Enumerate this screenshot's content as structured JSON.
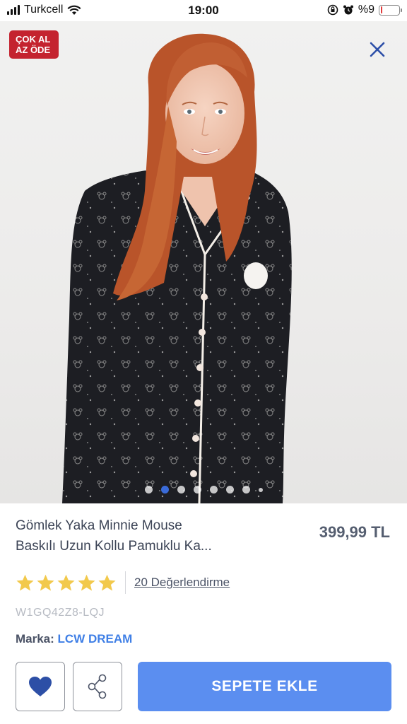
{
  "status_bar": {
    "carrier": "Turkcell",
    "time": "19:00",
    "battery": "%9",
    "battery_level": 0.09
  },
  "promo_badge": {
    "line1": "ÇOK AL",
    "line2": "AZ ÖDE",
    "color": "#c4232f"
  },
  "carousel": {
    "dot_count": 8,
    "active_index": 1
  },
  "product": {
    "title_line1": "Gömlek Yaka Minnie Mouse",
    "title_line2": "Baskılı Uzun Kollu Pamuklu Ka...",
    "price": "399,99 TL",
    "rating": 5,
    "reviews": "20 Değerlendirme",
    "sku": "W1GQ42Z8-LQJ",
    "brand_label": "Marka:",
    "brand": "LCW DREAM"
  },
  "actions": {
    "favorite_icon": "heart-icon",
    "share_icon": "share-icon",
    "add_to_cart": "SEPETE EKLE"
  },
  "colors": {
    "accent": "#5b8ef0",
    "brand_link": "#3f7fe6",
    "star": "#f2c94c"
  }
}
